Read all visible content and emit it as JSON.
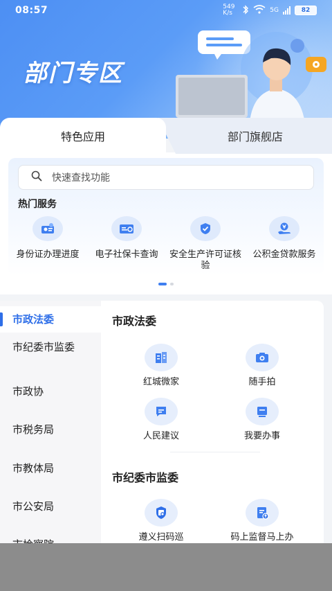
{
  "status": {
    "time": "08:57",
    "net_speed": "549 K/s",
    "network": "5G",
    "battery": "82"
  },
  "banner": {
    "title": "部门专区"
  },
  "tabs": [
    {
      "label": "特色应用",
      "active": true
    },
    {
      "label": "部门旗舰店",
      "active": false
    }
  ],
  "search": {
    "placeholder": "快速查找功能"
  },
  "hot_services": {
    "title": "热门服务",
    "items": [
      {
        "label": "身份证办理进度",
        "icon": "id-card-icon"
      },
      {
        "label": "电子社保卡查询",
        "icon": "social-card-icon"
      },
      {
        "label": "安全生产许可证核验",
        "icon": "shield-check-icon"
      },
      {
        "label": "公积金贷款服务",
        "icon": "yuan-hand-icon"
      }
    ]
  },
  "pager": {
    "pages": 2,
    "current": 1
  },
  "side_nav": {
    "items": [
      {
        "label": "市政法委",
        "active": true
      },
      {
        "label": "市纪委市监委",
        "active": false
      },
      {
        "label": "市政协",
        "active": false
      },
      {
        "label": "市税务局",
        "active": false
      },
      {
        "label": "市教体局",
        "active": false
      },
      {
        "label": "市公安局",
        "active": false
      },
      {
        "label": "市检察院",
        "active": false
      }
    ]
  },
  "sections": [
    {
      "title": "市政法委",
      "apps": [
        {
          "label": "红城微家",
          "icon": "building-icon"
        },
        {
          "label": "随手拍",
          "icon": "camera-icon"
        },
        {
          "label": "人民建议",
          "icon": "chat-bubble-icon"
        },
        {
          "label": "我要办事",
          "icon": "monitor-icon"
        }
      ]
    },
    {
      "title": "市纪委市监委",
      "apps": [
        {
          "label": "遵义扫码巡",
          "icon": "scan-shield-icon"
        },
        {
          "label": "码上监督马上办",
          "icon": "document-upload-icon"
        }
      ]
    }
  ],
  "colors": {
    "accent": "#2f6fe8",
    "banner": "#4d8ff3",
    "icon_bg": "#dfeafc"
  }
}
